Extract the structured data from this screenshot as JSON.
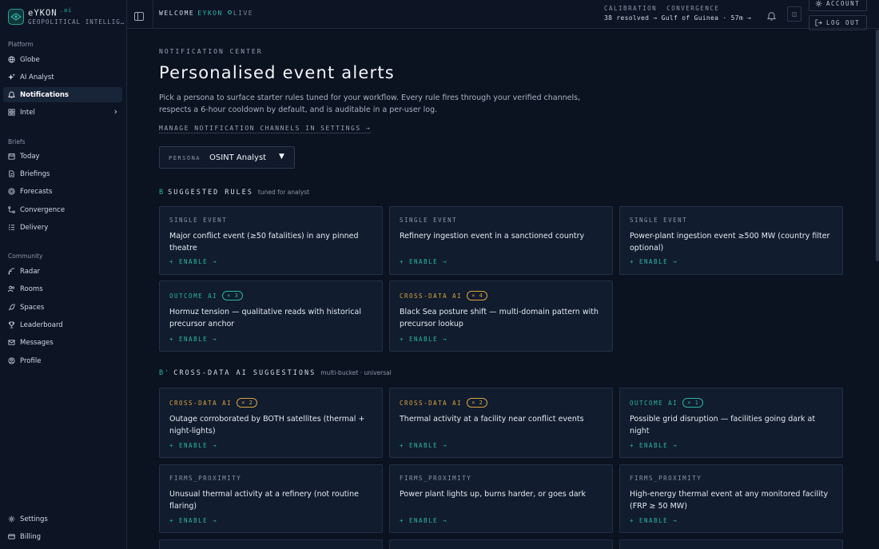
{
  "brand": {
    "name": "eYKON",
    "suffix": ".ai",
    "subtitle": "GEOPOLITICAL INTELLIG…"
  },
  "sidebar": {
    "sections": [
      {
        "label": "Platform",
        "items": [
          {
            "label": "Globe",
            "icon": "globe-icon"
          },
          {
            "label": "AI Analyst",
            "icon": "sparkles-icon"
          },
          {
            "label": "Notifications",
            "icon": "bell-icon",
            "active": true
          },
          {
            "label": "Intel",
            "icon": "grid-icon",
            "chevron": "›"
          }
        ]
      },
      {
        "label": "Briefs",
        "items": [
          {
            "label": "Today",
            "icon": "calendar-icon"
          },
          {
            "label": "Briefings",
            "icon": "document-icon"
          },
          {
            "label": "Forecasts",
            "icon": "target-icon"
          },
          {
            "label": "Convergence",
            "icon": "nodes-icon"
          },
          {
            "label": "Delivery",
            "icon": "list-icon"
          }
        ]
      },
      {
        "label": "Community",
        "items": [
          {
            "label": "Radar",
            "icon": "radar-icon"
          },
          {
            "label": "Rooms",
            "icon": "users-icon"
          },
          {
            "label": "Spaces",
            "icon": "rocket-icon"
          },
          {
            "label": "Leaderboard",
            "icon": "trophy-icon"
          },
          {
            "label": "Messages",
            "icon": "mail-icon"
          },
          {
            "label": "Profile",
            "icon": "user-circle-icon"
          }
        ]
      }
    ],
    "footer": [
      {
        "label": "Settings",
        "icon": "gear-icon"
      },
      {
        "label": "Billing",
        "icon": "card-icon"
      }
    ]
  },
  "topbar": {
    "welcome": "WELCOME",
    "user": "EYKON",
    "live": "LIVE",
    "calibration": "CALIBRATION",
    "convergence": "CONVERGENCE",
    "resolved": "38 resolved →",
    "location": "Gulf of Guinea · 57m →",
    "square_glyph": "◫",
    "account": "ACCOUNT",
    "logout": "LOG OUT"
  },
  "page": {
    "eyebrow": "NOTIFICATION CENTER",
    "title": "Personalised event alerts",
    "intro": "Pick a persona to surface starter rules tuned for your workflow. Every rule fires through your verified channels, respects a 6-hour cooldown by default, and is auditable in a per-user log.",
    "manage_link": "MANAGE NOTIFICATION CHANNELS IN SETTINGS →",
    "persona_label": "PERSONA",
    "persona_value": "OSINT Analyst",
    "persona_caret": "▼"
  },
  "section_b": {
    "letter": "B",
    "title": "SUGGESTED RULES",
    "tag": "tuned for analyst",
    "cards": [
      {
        "kind": "SINGLE EVENT",
        "title": "Major conflict event (≥50 fatalities) in any pinned theatre",
        "enable": "+ ENABLE →"
      },
      {
        "kind": "SINGLE EVENT",
        "title": "Refinery ingestion event in a sanctioned country",
        "enable": "+ ENABLE →"
      },
      {
        "kind": "SINGLE EVENT",
        "title": "Power-plant ingestion event ≥500 MW (country filter optional)",
        "enable": "+ ENABLE →"
      },
      {
        "kind": "OUTCOME AI",
        "badge": "× 3",
        "title": "Hormuz tension — qualitative reads with historical precursor anchor",
        "enable": "+ ENABLE →"
      },
      {
        "kind": "CROSS-DATA AI",
        "badge": "× 4",
        "title": "Black Sea posture shift — multi-domain pattern with precursor lookup",
        "enable": "+ ENABLE →"
      }
    ]
  },
  "section_b2": {
    "letter": "B'",
    "title": "CROSS-DATA AI SUGGESTIONS",
    "tag": "multi-bucket · universal",
    "cards": [
      {
        "kind": "CROSS-DATA AI",
        "badge": "× 2",
        "title": "Outage corroborated by BOTH satellites (thermal + night-lights)",
        "enable": "+ ENABLE →"
      },
      {
        "kind": "CROSS-DATA AI",
        "badge": "× 2",
        "title": "Thermal activity at a facility near conflict events",
        "enable": "+ ENABLE →"
      },
      {
        "kind": "OUTCOME AI",
        "badge": "× 1",
        "title": "Possible grid disruption — facilities going dark at night",
        "enable": "+ ENABLE →"
      },
      {
        "kind": "FIRMS_PROXIMITY",
        "title": "Unusual thermal activity at a refinery (not routine flaring)",
        "enable": "+ ENABLE →"
      },
      {
        "kind": "FIRMS_PROXIMITY",
        "title": "Power plant lights up, burns harder, or goes dark",
        "enable": "+ ENABLE →"
      },
      {
        "kind": "FIRMS_PROXIMITY",
        "title": "High-energy thermal event at any monitored facility (FRP ≥ 50 MW)",
        "enable": "+ ENABLE →"
      }
    ]
  },
  "colors": {
    "accent": "#2bb5a6",
    "amber": "#d9a441",
    "bg": "#0b1220",
    "card": "#111c2e"
  }
}
